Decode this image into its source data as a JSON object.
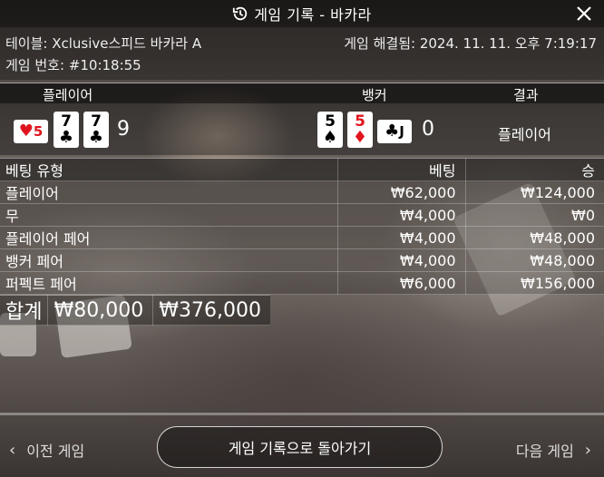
{
  "window": {
    "title": "게임 기록 - 바카라",
    "icon": "history-icon",
    "close_icon": "close-icon"
  },
  "info": {
    "table": "테이블: Xclusive스피드 바카라 A",
    "resolved": "게임 해결됨: 2024. 11. 11. 오후 7:19:17",
    "game_no": "게임 번호: #10:18:55"
  },
  "score": {
    "player_label": "플레이어",
    "banker_label": "뱅커",
    "result_label": "결과",
    "player_cards": [
      {
        "rank": "5",
        "suit": "♥",
        "color": "#e0141e",
        "sideways": true
      },
      {
        "rank": "7",
        "suit": "♣",
        "color": "#000000",
        "sideways": false
      },
      {
        "rank": "7",
        "suit": "♣",
        "color": "#000000",
        "sideways": false
      }
    ],
    "player_total": "9",
    "banker_cards": [
      {
        "rank": "5",
        "suit": "♠",
        "color": "#000000",
        "sideways": false
      },
      {
        "rank": "5",
        "suit": "♦",
        "color": "#e0141e",
        "sideways": false
      },
      {
        "rank": "J",
        "suit": "♣",
        "color": "#000000",
        "sideways": true
      }
    ],
    "banker_total": "0",
    "result": "플레이어"
  },
  "bets": {
    "headers": [
      "베팅 유형",
      "베팅",
      "승"
    ],
    "rows": [
      [
        "플레이어",
        "₩62,000",
        "₩124,000"
      ],
      [
        "무",
        "₩4,000",
        "₩0"
      ],
      [
        "플레이어 페어",
        "₩4,000",
        "₩48,000"
      ],
      [
        "뱅커 페어",
        "₩4,000",
        "₩48,000"
      ],
      [
        "퍼펙트 페어",
        "₩6,000",
        "₩156,000"
      ]
    ],
    "total": [
      "합계",
      "₩80,000",
      "₩376,000"
    ]
  },
  "footer": {
    "prev": "이전 게임",
    "back": "게임 기록으로 돌아가기",
    "next": "다음 게임"
  }
}
